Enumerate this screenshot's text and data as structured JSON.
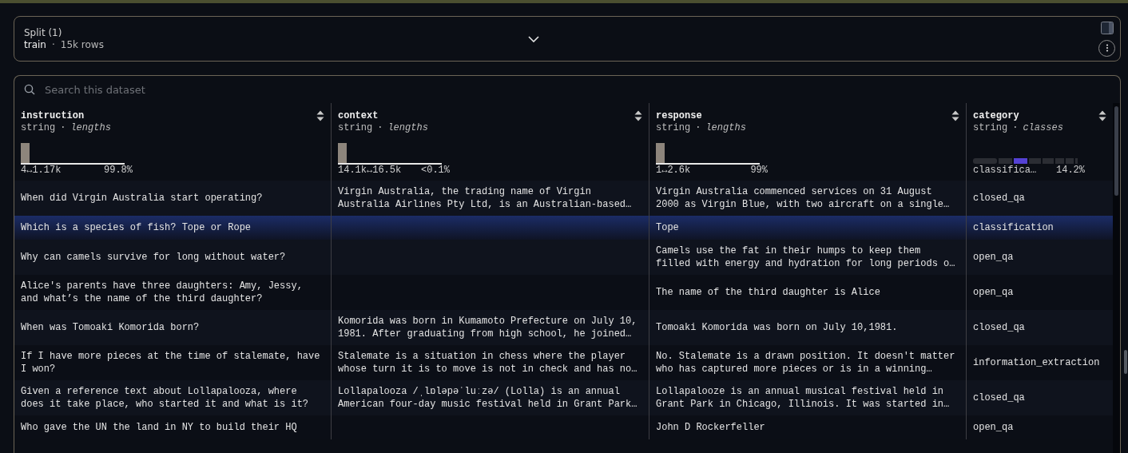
{
  "split": {
    "label": "Split (1)",
    "name": "train",
    "dot": "·",
    "rows": "15k rows"
  },
  "search": {
    "placeholder": "Search this dataset"
  },
  "columns": [
    {
      "name": "instruction",
      "type": "string",
      "dot": "·",
      "stat": "lengths",
      "kind": "histogram",
      "range": "4↔1.17k",
      "percent": "99.8%"
    },
    {
      "name": "context",
      "type": "string",
      "dot": "·",
      "stat": "lengths",
      "kind": "histogram",
      "range": "14.1k↔16.5k",
      "percent": "<0.1%"
    },
    {
      "name": "response",
      "type": "string",
      "dot": "·",
      "stat": "lengths",
      "kind": "histogram",
      "range": "1↔2.6k",
      "percent": "99%"
    },
    {
      "name": "category",
      "type": "string",
      "dot": "·",
      "stat": "classes",
      "kind": "classes",
      "range": "classifica…",
      "percent": "14.2%"
    }
  ],
  "rows": [
    {
      "selected": false,
      "cells": [
        "When did Virgin Australia start operating?",
        "Virgin Australia, the trading name of Virgin Australia Airlines Pty Ltd, is an Australian-based…",
        "Virgin Australia commenced services on 31 August 2000 as Virgin Blue, with two aircraft on a single…",
        "closed_qa"
      ]
    },
    {
      "selected": true,
      "cells": [
        "Which is a species of fish? Tope or Rope",
        "",
        "Tope",
        "classification"
      ]
    },
    {
      "selected": false,
      "cells": [
        "Why can camels survive for long without water?",
        "",
        "Camels use the fat in their humps to keep them filled with energy and hydration for long periods o…",
        "open_qa"
      ]
    },
    {
      "selected": false,
      "cells": [
        "Alice's parents have three daughters: Amy, Jessy, and what’s the name of the third daughter?",
        "",
        "The name of the third daughter is Alice",
        "open_qa"
      ]
    },
    {
      "selected": false,
      "cells": [
        "When was Tomoaki Komorida born?",
        "Komorida was born in Kumamoto Prefecture on July 10, 1981. After graduating from high school, he joined…",
        "Tomoaki Komorida was born on July 10,1981.",
        "closed_qa"
      ]
    },
    {
      "selected": false,
      "cells": [
        "If I have more pieces at the time of stalemate, have I won?",
        "Stalemate is a situation in chess where the player whose turn it is to move is not in check and has no…",
        "No. Stalemate is a drawn position. It doesn't matter who has captured more pieces or is in a winning…",
        "information_extraction"
      ]
    },
    {
      "selected": false,
      "cells": [
        "Given a reference text about Lollapalooza, where does it take place, who started it and what is it?",
        "Lollapalooza /ˌlɒləpəˈluːzə/ (Lolla) is an annual American four-day music festival held in Grant Park…",
        "Lollapalooze is an annual musical festival held in Grant Park in Chicago, Illinois. It was started in…",
        "closed_qa"
      ]
    },
    {
      "selected": false,
      "cells": [
        "Who gave the UN the land in NY to build their HQ",
        "",
        "John D Rockerfeller",
        "open_qa"
      ]
    }
  ]
}
